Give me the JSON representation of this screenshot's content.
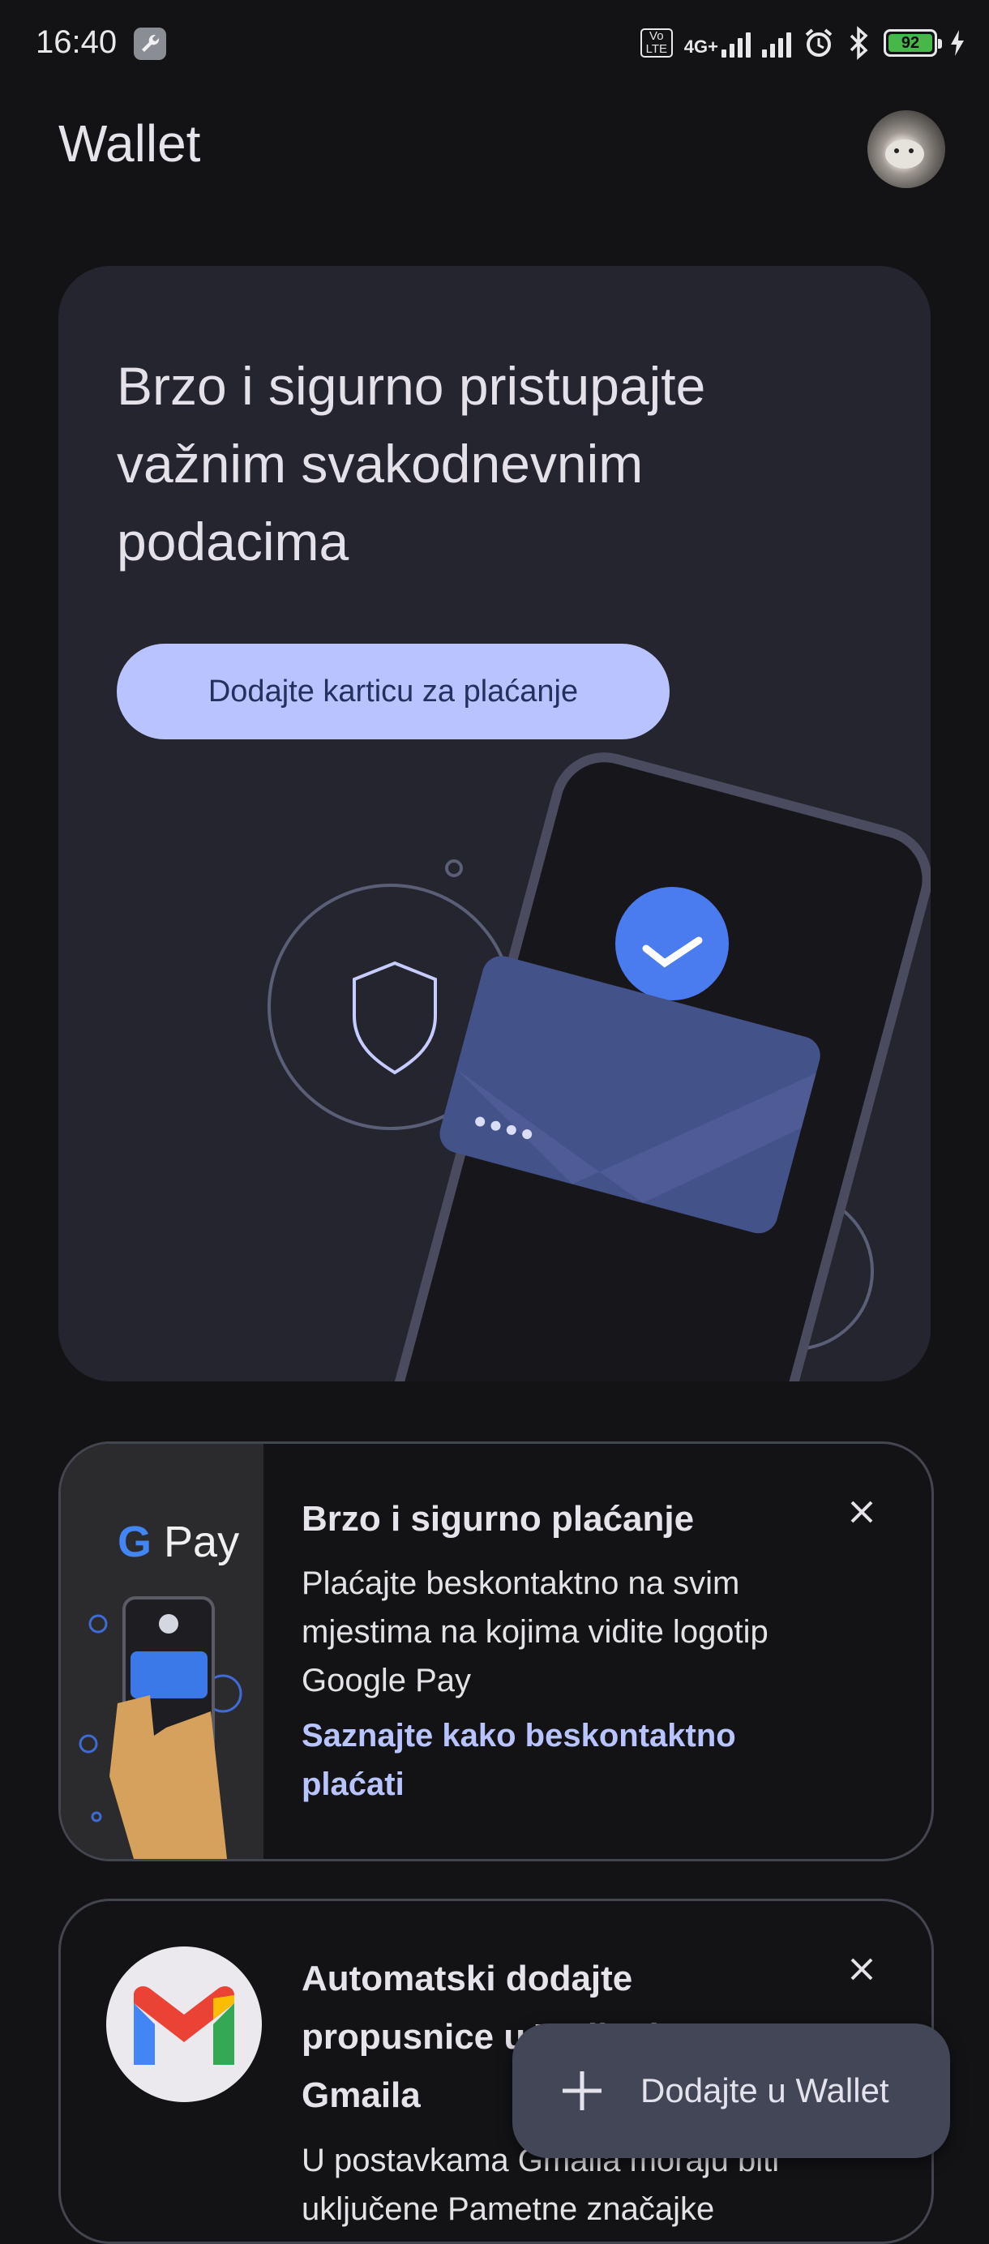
{
  "status_bar": {
    "time": "16:40",
    "network_label": "4G+",
    "volte_label": "Vo LTE",
    "battery_level": "92",
    "icons": [
      "wrench-icon",
      "volte-icon",
      "signal-icon",
      "signal-icon-2",
      "alarm-icon",
      "bluetooth-icon",
      "battery-icon",
      "charging-icon"
    ]
  },
  "app_bar": {
    "title": "Wallet",
    "avatar": "profile-avatar"
  },
  "hero": {
    "title": "Brzo i sigurno pristupajte važnim svakodnevnim podacima",
    "button_label": "Dodajte karticu za plaćanje",
    "illustration": "phone-card-shield-illustration",
    "colors": {
      "accent": "#b9c3ff",
      "check": "#4a7cf0",
      "card": "#44528a"
    }
  },
  "promo_card": {
    "logo_text": "Pay",
    "title": "Brzo i sigurno plaćanje",
    "body": "Plaćajte beskontaktno na svim mjestima na kojima vidite logotip Google Pay",
    "link": "Saznajte kako beskontaktno plaćati",
    "close_icon": "close-icon"
  },
  "gmail_card": {
    "title": "Automatski dodajte propusnice u Wallet iz Gmaila",
    "body": "U postavkama Gmaila moraju biti uključene Pametne značajke",
    "close_icon": "close-icon"
  },
  "fab": {
    "label": "Dodajte u Wallet",
    "icon": "plus-icon"
  }
}
